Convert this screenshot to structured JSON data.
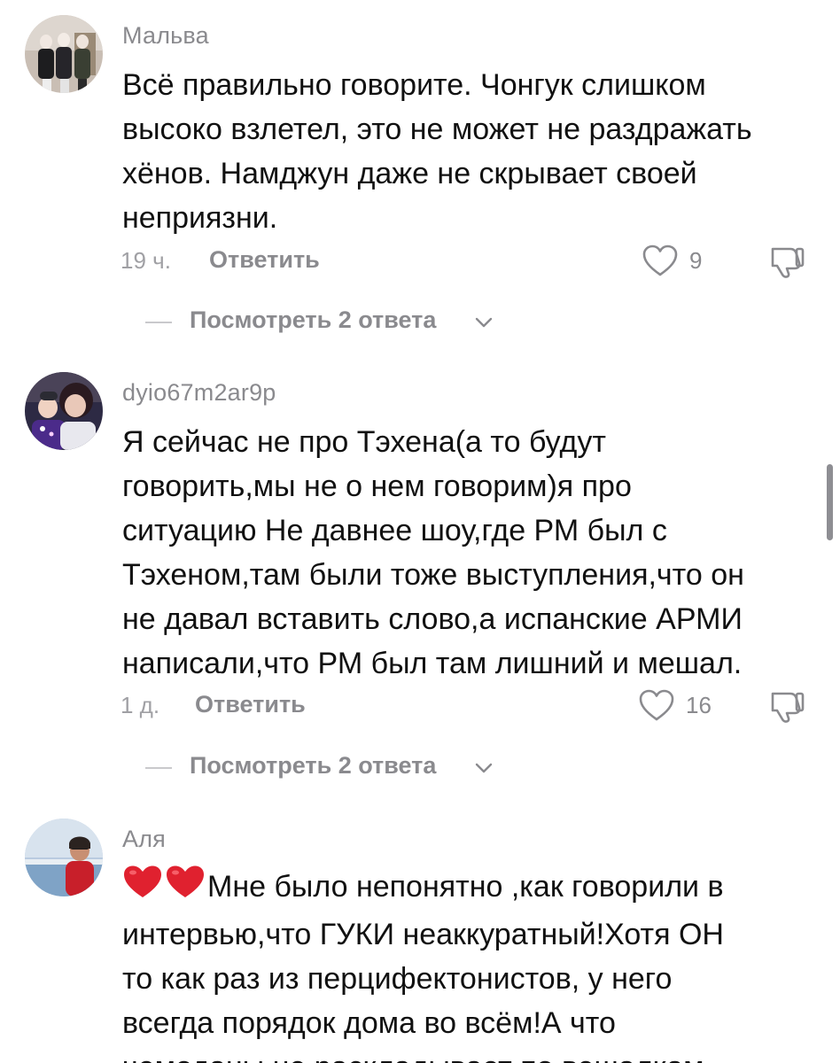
{
  "comments": [
    {
      "username": "Мальва",
      "lines": [
        "Всё правильно говорите. Чонгук слишком",
        "высоко взлетел, это не может не раздражать",
        "хёнов. Намджун даже не скрывает своей",
        "неприязни."
      ],
      "time": "19 ч.",
      "reply_label": "Ответить",
      "likes": "9",
      "view_replies": "Посмотреть 2 ответа"
    },
    {
      "username": "dyio67m2ar9p",
      "lines": [
        "Я сейчас не про Тэхена(а то будут",
        "говорить,мы не о нем говорим)я про",
        "ситуацию Не давнее шоу,где РМ был с",
        "Тэхеном,там были тоже выступления,что он",
        "не давал вставить слово,а испанские АРМИ",
        "написали,что РМ был там лишний и мешал."
      ],
      "time": "1 д.",
      "reply_label": "Ответить",
      "likes": "16",
      "view_replies": "Посмотреть 2 ответа"
    },
    {
      "username": "Аля",
      "emoji": "❤️❤️",
      "lines": [
        "Мне было непонятно ,как говорили в",
        "интервью,что ГУКИ неаккуратный!Хотя ОН",
        "то как раз из перцифектонистов, у него",
        "всегда порядок дома во всём!А что",
        "чемоданы не раскладывает по вешалкам"
      ]
    }
  ],
  "icons": {
    "like": "heart-outline-icon",
    "dislike": "thumbs-down-icon",
    "chevron": "chevron-down-icon"
  },
  "colors": {
    "text": "#111111",
    "secondary": "#8a8a8e",
    "heart": "#e0212f"
  }
}
